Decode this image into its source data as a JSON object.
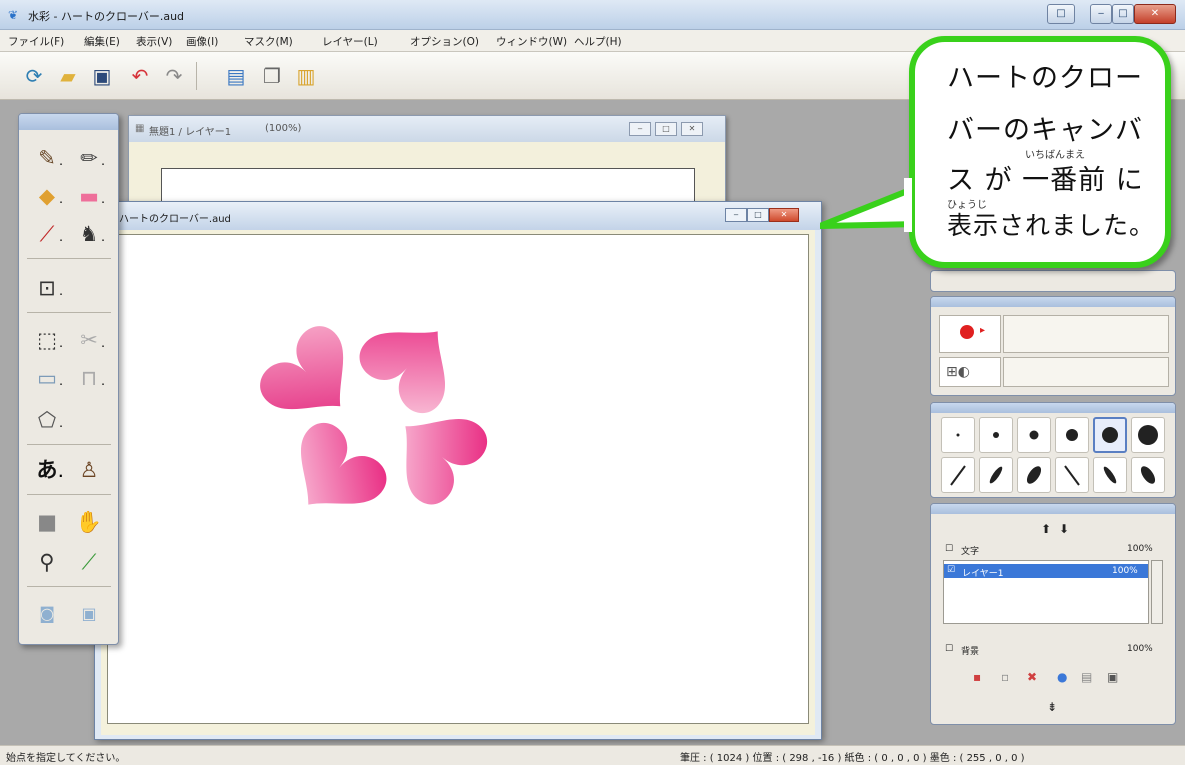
{
  "window": {
    "title": "水彩 - ハートのクローバー.aud",
    "controls": [
      "‒",
      "□",
      "✕"
    ],
    "right_small": "□"
  },
  "menu": [
    "ファイル(F)",
    "編集(E)",
    "表示(V)",
    "画像(I)",
    "マスク(M)",
    "レイヤー(L)",
    "オプション(O)",
    "ウィンドウ(W)",
    "ヘルプ(H)"
  ],
  "toolbar_icons": [
    "new-canvas-icon",
    "open-folder-icon",
    "save-disk-icon",
    "undo-icon",
    "redo-icon",
    "image-icon",
    "copy-icon",
    "paste-icon"
  ],
  "doc_back": {
    "title": "無題1 / レイヤー1",
    "zoom": "(100%)",
    "controls": [
      "‒",
      "□",
      "✕"
    ]
  },
  "doc_front": {
    "title": "ハートのクローバー.aud",
    "controls": [
      "‒",
      "□",
      "✕"
    ]
  },
  "layers": {
    "rows": [
      {
        "name": "文字",
        "opacity": "100%"
      },
      {
        "name": "レイヤー1",
        "opacity": "100%"
      },
      {
        "name": "背景",
        "opacity": "100%"
      }
    ]
  },
  "callout": {
    "lines": [
      "ハートのクロー",
      "バーのキャンバ",
      "ス が 一番前 に",
      "表示されました。"
    ],
    "ruby_1": "いちばんまえ",
    "ruby_2": "ひょうじ"
  },
  "status": {
    "message": "始点を指定してください。",
    "info": "筆圧 : ( 1024 ) 位置 : ( 298 , -16 )   紙色 : ( 0 , 0 , 0 )   墨色 : ( 255 , 0 , 0 )"
  },
  "colors": {
    "callout_border": "#39d11b",
    "heart_deep": "#e8247e",
    "heart_light": "#fbd2e4",
    "current_color": "#e02020"
  }
}
